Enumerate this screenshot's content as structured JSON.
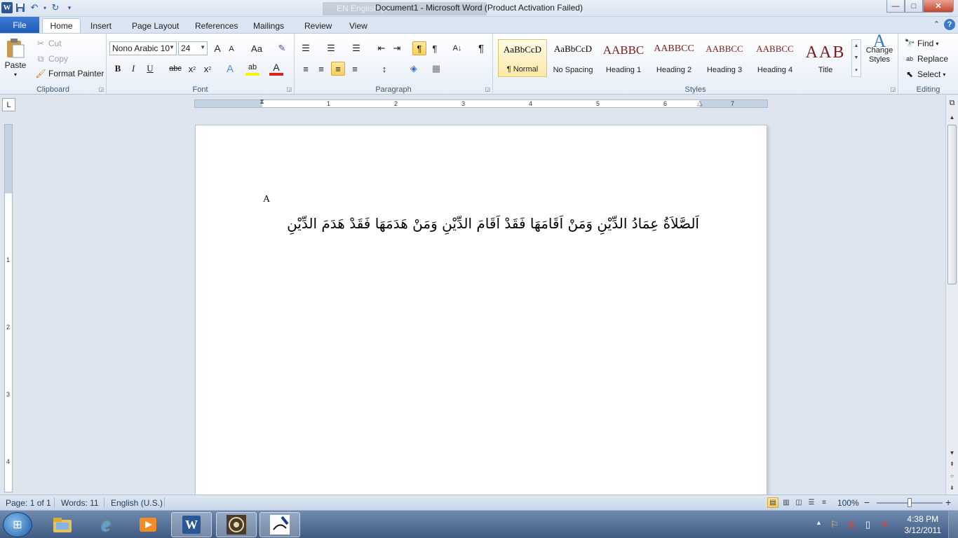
{
  "window": {
    "title": "Document1  -  Microsoft Word (Product Activation Failed)",
    "language_indicator": "EN English (U",
    "controls": {
      "minimize": "—",
      "maximize": "□",
      "close": "✕"
    }
  },
  "qat": {
    "app_icon": "W",
    "save_icon": "💾",
    "undo_icon": "↶",
    "redo_icon": "↻",
    "customize_icon": "▾"
  },
  "tabs": {
    "file": "File",
    "items": [
      "Home",
      "Insert",
      "Page Layout",
      "References",
      "Mailings",
      "Review",
      "View"
    ],
    "active": "Home",
    "help": "?",
    "minimize_ribbon": "⌃"
  },
  "ribbon": {
    "clipboard": {
      "label": "Clipboard",
      "paste": "Paste",
      "cut": "Cut",
      "copy": "Copy",
      "format_painter": "Format Painter"
    },
    "font": {
      "label": "Font",
      "font_name": "Nono Arabic 10",
      "font_size": "24",
      "grow": "A",
      "shrink": "A",
      "change_case": "Aa",
      "clear_format": "✎",
      "bold": "B",
      "italic": "I",
      "underline": "U",
      "strike": "abc",
      "subscript": "x",
      "superscript": "x",
      "text_effects": "A",
      "highlight": "ab",
      "font_color": "A"
    },
    "paragraph": {
      "label": "Paragraph",
      "bullets": "☰",
      "numbering": "☰",
      "multilevel": "☰",
      "dec_indent": "⇤",
      "inc_indent": "⇥",
      "ltr": "¶",
      "rtl": "¶",
      "sort": "A↓",
      "show_marks": "¶",
      "align_left": "≡",
      "center": "≡",
      "align_right": "≡",
      "justify": "≡",
      "line_spacing": "↕",
      "shading": "◈",
      "borders": "▦"
    },
    "styles": {
      "label": "Styles",
      "items": [
        {
          "sample": "AaBbCcD",
          "name": "¶ Normal"
        },
        {
          "sample": "AaBbCcD",
          "name": "No Spacing"
        },
        {
          "sample": "AABBC",
          "name": "Heading 1"
        },
        {
          "sample": "AABBCC",
          "name": "Heading 2"
        },
        {
          "sample": "AABBCC",
          "name": "Heading 3"
        },
        {
          "sample": "AABBCC",
          "name": "Heading 4"
        },
        {
          "sample": "AAB",
          "name": "Title"
        }
      ],
      "change_styles": "Change Styles",
      "heading_color": "#7b1c1c"
    },
    "editing": {
      "label": "Editing",
      "find": "Find",
      "replace": "Replace",
      "select": "Select"
    }
  },
  "ruler": {
    "tab_selector": "L",
    "numbers": [
      "1",
      "1",
      "2",
      "3",
      "4",
      "5",
      "6",
      "7"
    ],
    "vertical_numbers": [
      "1",
      "2",
      "3",
      "4"
    ]
  },
  "document": {
    "line1": "A",
    "line2": "اَلصَّلاَةُ عِمَادُ الدِّيْنِ وَمَنْ اَقَامَهَا فَقَدْ اَقَامَ الدِّيْنِ وَمَنْ هَدَمَهَا فَقَدْ هَدَمَ الدِّيْنِ"
  },
  "status": {
    "page": "Page: 1 of 1",
    "words": "Words: 11",
    "language": "English (U.S.)",
    "zoom": "100%",
    "zoom_minus": "−",
    "zoom_plus": "+",
    "zoom_level": 0.5
  },
  "taskbar": {
    "start": "⊞",
    "apps": [
      "explorer-icon",
      "internet-explorer-icon",
      "media-player-icon",
      "word-icon",
      "app-icon",
      "arabic-pen-icon"
    ],
    "tray": {
      "arrow": "▲"
    },
    "time": "4:38 PM",
    "date": "3/12/2011"
  },
  "colors": {
    "accent": "#2b5797",
    "ribbon_bg": "#e7eef7",
    "selected_style": "#fde9a6"
  }
}
